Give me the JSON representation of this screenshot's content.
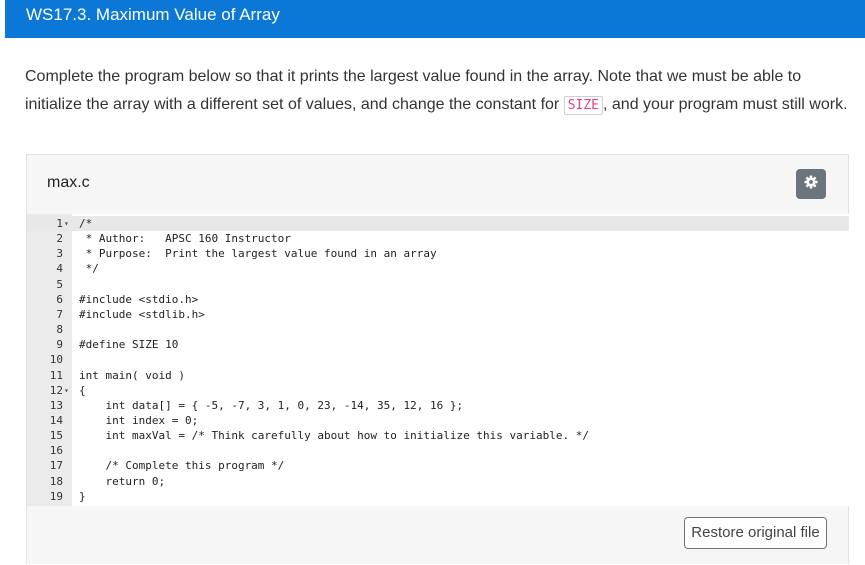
{
  "header": {
    "title": "WS17.3. Maximum Value of Array"
  },
  "description": {
    "before": "Complete the program below so that it prints the largest value found in the array. Note that we must be able to initialize the array with a different set of values, and change the constant for ",
    "code": "SIZE",
    "after": ", and your program must still work."
  },
  "editor": {
    "filename": "max.c",
    "settings_icon": "gear-icon",
    "fold_icon": "chevron-down-icon",
    "lines": [
      {
        "n": "1",
        "code": "/*",
        "fold": true
      },
      {
        "n": "2",
        "code": " * Author:   APSC 160 Instructor"
      },
      {
        "n": "3",
        "code": " * Purpose:  Print the largest value found in an array"
      },
      {
        "n": "4",
        "code": " */"
      },
      {
        "n": "5",
        "code": ""
      },
      {
        "n": "6",
        "code": "#include <stdio.h>"
      },
      {
        "n": "7",
        "code": "#include <stdlib.h>"
      },
      {
        "n": "8",
        "code": ""
      },
      {
        "n": "9",
        "code": "#define SIZE 10"
      },
      {
        "n": "10",
        "code": ""
      },
      {
        "n": "11",
        "code": "int main( void )"
      },
      {
        "n": "12",
        "code": "{",
        "fold": true
      },
      {
        "n": "13",
        "code": "    int data[] = { -5, -7, 3, 1, 0, 23, -14, 35, 12, 16 };"
      },
      {
        "n": "14",
        "code": "    int index = 0;"
      },
      {
        "n": "15",
        "code": "    int maxVal = /* Think carefully about how to initialize this variable. */"
      },
      {
        "n": "16",
        "code": ""
      },
      {
        "n": "17",
        "code": "    /* Complete this program */"
      },
      {
        "n": "18",
        "code": "    return 0;"
      },
      {
        "n": "19",
        "code": "}"
      }
    ]
  },
  "restore_button": {
    "label": "Restore original file"
  }
}
